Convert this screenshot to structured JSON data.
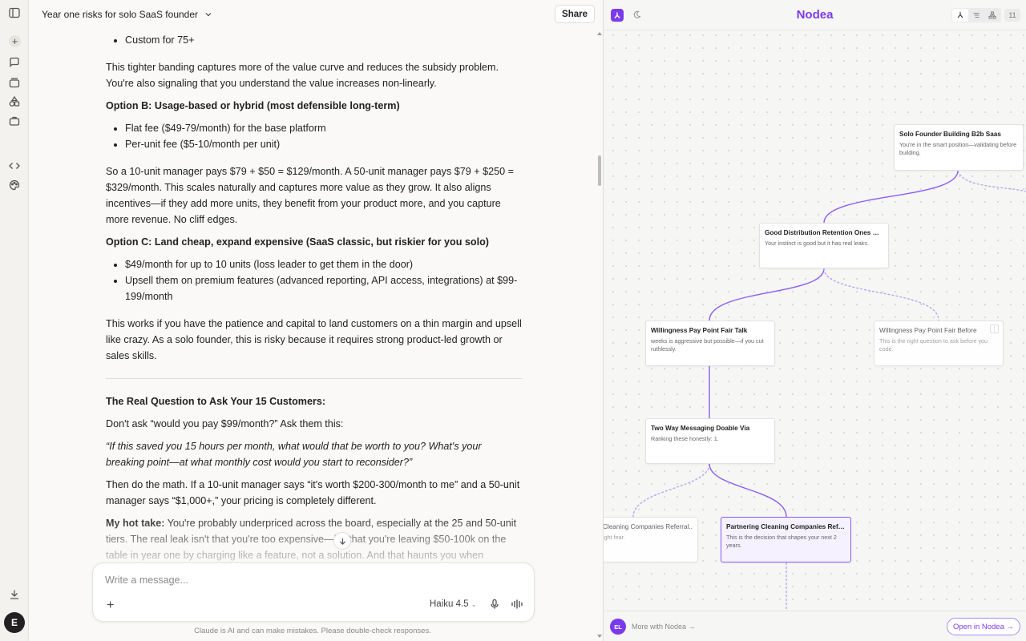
{
  "chat": {
    "title": "Year one risks for solo SaaS founder",
    "share_label": "Share",
    "messages": {
      "li_custom": "Custom for 75+",
      "p_tighter": "This tighter banding captures more of the value curve and reduces the subsidy problem. You're also signaling that you understand the value increases non-linearly.",
      "h_option_b": "Option B: Usage-based or hybrid (most defensible long-term)",
      "li_flat": "Flat fee ($49-79/month) for the base platform",
      "li_perunit": "Per-unit fee ($5-10/month per unit)",
      "p_so": "So a 10-unit manager pays $79 + $50 = $129/month. A 50-unit manager pays $79 + $250 = $329/month. This scales naturally and captures more value as they grow. It also aligns incentives—if they add more units, they benefit from your product more, and you capture more revenue. No cliff edges.",
      "h_option_c": "Option C: Land cheap, expand expensive (SaaS classic, but riskier for you solo)",
      "li_49": "$49/month for up to 10 units (loss leader to get them in the door)",
      "li_upsell": "Upsell them on premium features (advanced reporting, API access, integrations) at $99-199/month",
      "p_works": "This works if you have the patience and capital to land customers on a thin margin and upsell like crazy. As a solo founder, this is risky because it requires strong product-led growth or sales skills.",
      "h_real": "The Real Question to Ask Your 15 Customers:",
      "p_dont": "Don't ask “would you pay $99/month?” Ask them this:",
      "p_quote": "“If this saved you 15 hours per month, what would that be worth to you? What's your breaking point—at what monthly cost would you start to reconsider?”",
      "p_then": "Then do the math. If a 10-unit manager says “it's worth $200-300/month to me” and a 50-unit manager says “$1,000+,” your pricing is completely different.",
      "hot_label": "My hot take:",
      "hot_text": " You're probably underpriced across the board, especially at the 25 and 50-unit tiers. The real leak isn't that you're too expensive—it's that you're leaving $50-100k on the table in year one by charging like a feature, not a solution. And that haunts you when"
    },
    "composer": {
      "placeholder": "Write a message...",
      "model": "Haiku 4.5"
    },
    "disclaimer": "Claude is AI and can make mistakes. Please double-check responses."
  },
  "nodea": {
    "brand": "Nodea",
    "count": "11",
    "nodes": [
      {
        "title": "Solo Founder Building B2b Saas",
        "desc": "You're in the smart position—validating before building."
      },
      {
        "title": "Good Distribution Retention Ones Keep...",
        "desc": "Your instinct is good but it has real leaks."
      },
      {
        "title": "Willingness Pay Point Fair Talk",
        "desc": "weeks is aggressive but possible—if you cut ruthlessly."
      },
      {
        "title": "Willingness Pay Point Fair Before",
        "desc": "This is the right question to ask before you code."
      },
      {
        "title": "Two Way Messaging Doable Via",
        "desc": "Ranking these honestly: 1."
      },
      {
        "title": "Cleaning Companies Referral...",
        "desc": "ight fear."
      },
      {
        "title": "Partnering Cleaning Companies Referral...",
        "desc": "This is the decision that shapes your next 2 years."
      }
    ],
    "footer": {
      "avatar": "EL",
      "more": "More with Nodea →",
      "open": "Open in Nodea →"
    }
  },
  "user": {
    "avatar_initial": "E"
  }
}
